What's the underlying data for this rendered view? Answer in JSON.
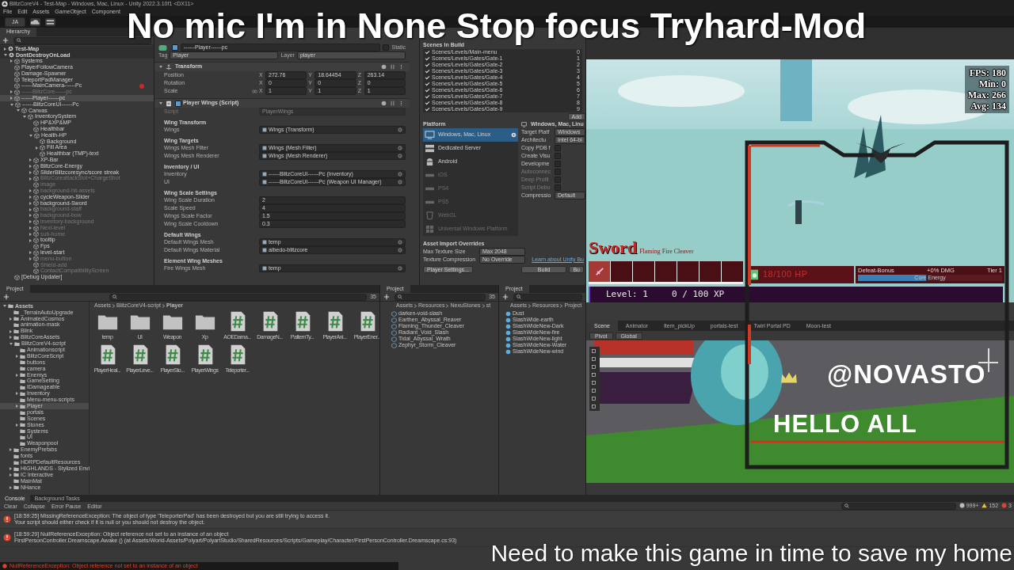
{
  "window": {
    "title": "BlitzCoreV4 - Test-Map - Windows, Mac, Linux - Unity 2022.3.10f1 <DX11>"
  },
  "menu": [
    "File",
    "Edit",
    "Assets",
    "GameObject",
    "Component"
  ],
  "toolbar": {
    "account": "JA"
  },
  "hierarchy": {
    "title": "Hierarchy",
    "items": [
      {
        "name": "Test-Map",
        "kind": "scene",
        "active": true,
        "selected": false,
        "expanded": false
      },
      {
        "name": "DontDestroyOnLoad",
        "kind": "scene",
        "active": true,
        "selected": false,
        "expanded": true,
        "children": [
          {
            "name": "Systems",
            "kind": "object",
            "active": true,
            "selected": false,
            "expanded": false
          },
          {
            "name": "PlayerFollowCamera",
            "kind": "object",
            "active": true,
            "selected": false
          },
          {
            "name": "Damage-Spawner",
            "kind": "object",
            "active": true,
            "selected": false
          },
          {
            "name": "TeleportPadManager",
            "kind": "object",
            "active": true,
            "selected": false
          },
          {
            "name": "------MainCamera------Pc",
            "kind": "object",
            "active": true,
            "selected": false,
            "marker": true
          },
          {
            "name": "------BlitzCore------pc",
            "kind": "object",
            "active": false,
            "selected": false,
            "expanded": false
          },
          {
            "name": "------Player------pc",
            "kind": "object",
            "active": true,
            "selected": true,
            "expanded": false
          },
          {
            "name": "------BlitzCoreUI------Pc",
            "kind": "object",
            "active": true,
            "selected": false,
            "expanded": true,
            "children": [
              {
                "name": "Canvas",
                "kind": "object",
                "active": true,
                "selected": false,
                "expanded": true,
                "children": [
                  {
                    "name": "InventorySystem",
                    "kind": "object",
                    "active": true,
                    "selected": false,
                    "expanded": true,
                    "children": [
                      {
                        "name": "HP&XP&MP",
                        "kind": "object",
                        "active": true,
                        "selected": false
                      },
                      {
                        "name": "Healthbar",
                        "kind": "object",
                        "active": true,
                        "selected": false
                      },
                      {
                        "name": "Health-HP",
                        "kind": "object",
                        "active": true,
                        "selected": false,
                        "expanded": true,
                        "children": [
                          {
                            "name": "Background",
                            "kind": "object",
                            "active": true,
                            "selected": false
                          },
                          {
                            "name": "Fill Area",
                            "kind": "object",
                            "active": true,
                            "selected": false,
                            "expanded": false
                          },
                          {
                            "name": "Healthbar (TMP)-text",
                            "kind": "object",
                            "active": true,
                            "selected": false
                          }
                        ]
                      },
                      {
                        "name": "XP-Bar",
                        "kind": "object",
                        "active": true,
                        "selected": false,
                        "expanded": false
                      },
                      {
                        "name": "BlitzCore-Energy",
                        "kind": "object",
                        "active": true,
                        "selected": false,
                        "expanded": false
                      },
                      {
                        "name": "SliderBlitzcoresync/score streak",
                        "kind": "object",
                        "active": true,
                        "selected": false,
                        "expanded": false
                      },
                      {
                        "name": "BlitzCoreattackSlot+ChargeShot",
                        "kind": "object",
                        "active": false,
                        "selected": false,
                        "expanded": false
                      },
                      {
                        "name": "image",
                        "kind": "object",
                        "active": false,
                        "selected": false
                      },
                      {
                        "name": "background-hit-assets",
                        "kind": "object",
                        "active": false,
                        "selected": false,
                        "expanded": false
                      },
                      {
                        "name": "cycleWeapon-Slider",
                        "kind": "object",
                        "active": true,
                        "selected": false,
                        "expanded": false
                      },
                      {
                        "name": "background-Sword",
                        "kind": "object",
                        "active": true,
                        "selected": false,
                        "expanded": false
                      },
                      {
                        "name": "background-staff",
                        "kind": "object",
                        "active": false,
                        "selected": false,
                        "expanded": false
                      },
                      {
                        "name": "background-bow",
                        "kind": "object",
                        "active": false,
                        "selected": false,
                        "expanded": false
                      },
                      {
                        "name": "inventory-background",
                        "kind": "object",
                        "active": false,
                        "selected": false,
                        "expanded": false
                      },
                      {
                        "name": "Next-level",
                        "kind": "object",
                        "active": false,
                        "selected": false,
                        "expanded": false
                      },
                      {
                        "name": "sub-home",
                        "kind": "object",
                        "active": false,
                        "selected": false,
                        "expanded": false
                      },
                      {
                        "name": "tooltip",
                        "kind": "object",
                        "active": true,
                        "selected": false,
                        "expanded": false
                      },
                      {
                        "name": "Fps",
                        "kind": "object",
                        "active": true,
                        "selected": false
                      },
                      {
                        "name": "level-start",
                        "kind": "object",
                        "active": true,
                        "selected": false,
                        "expanded": false
                      },
                      {
                        "name": "menu-button",
                        "kind": "object",
                        "active": false,
                        "selected": false,
                        "expanded": false
                      },
                      {
                        "name": "Shield-add",
                        "kind": "object",
                        "active": false,
                        "selected": false
                      },
                      {
                        "name": "ContactCompatibilityScreen",
                        "kind": "object",
                        "active": false,
                        "selected": false
                      }
                    ]
                  }
                ]
              }
            ]
          },
          {
            "name": "[Debug Updater]",
            "kind": "object",
            "active": true,
            "selected": false
          }
        ]
      }
    ]
  },
  "inspector": {
    "object_name": "------Player------pc",
    "active": true,
    "static_label": "Static",
    "static": false,
    "tag_label": "Tag",
    "tag": "Player",
    "layer_label": "Layer",
    "layer": "player",
    "transform": {
      "title": "Transform",
      "expanded": true,
      "rows": [
        {
          "label": "Position",
          "values": [
            {
              "axis": "X",
              "value": "272.76"
            },
            {
              "axis": "Y",
              "value": "18.64454"
            },
            {
              "axis": "Z",
              "value": "263.14"
            }
          ]
        },
        {
          "label": "Rotation",
          "values": [
            {
              "axis": "X",
              "value": "0"
            },
            {
              "axis": "Y",
              "value": "0"
            },
            {
              "axis": "Z",
              "value": "0"
            }
          ]
        },
        {
          "label": "Scale",
          "values": [
            {
              "axis": "X",
              "value": "1"
            },
            {
              "axis": "Y",
              "value": "1"
            },
            {
              "axis": "Z",
              "value": "1"
            }
          ]
        }
      ]
    },
    "component": {
      "title": "Player Wings (Script)",
      "expanded": true,
      "enabled": true,
      "script_label": "Script",
      "script": "PlayerWings",
      "sections": [
        {
          "heading": "Wing Transform",
          "fields": [
            {
              "label": "Wings",
              "kind": "object",
              "value": "Wings (Transform)"
            }
          ]
        },
        {
          "heading": "Wing Targets",
          "fields": [
            {
              "label": "Wings Mesh Filter",
              "kind": "object",
              "value": "Wings (Mesh Filter)"
            },
            {
              "label": "Wings Mesh Renderer",
              "kind": "object",
              "value": "Wings (Mesh Renderer)"
            }
          ]
        },
        {
          "heading": "Inventory / UI",
          "fields": [
            {
              "label": "Inventory",
              "kind": "object",
              "value": "------BlitzCoreUI------Pc (Inventory)"
            },
            {
              "label": "UI",
              "kind": "object",
              "value": "------BlitzCoreUI------Pc (Weapon UI Manager)"
            }
          ]
        },
        {
          "heading": "Wing Scale Settings",
          "fields": [
            {
              "label": "Wing Scale Duration",
              "kind": "number",
              "value": "2"
            },
            {
              "label": "Scale Speed",
              "kind": "number",
              "value": "4"
            },
            {
              "label": "Wings Scale Factor",
              "kind": "number",
              "value": "1.5"
            },
            {
              "label": "Wing Scale Cooldown",
              "kind": "number",
              "value": "0.3"
            }
          ]
        },
        {
          "heading": "Default Wings",
          "fields": [
            {
              "label": "Default Wings Mesh",
              "kind": "object",
              "value": "temp"
            },
            {
              "label": "Default Wings Material",
              "kind": "object",
              "value": "albedo-blitzcore"
            }
          ]
        },
        {
          "heading": "Element Wing Meshes",
          "fields": [
            {
              "label": "Fire Wings Mesh",
              "kind": "object",
              "value": "temp"
            }
          ]
        }
      ]
    }
  },
  "build_settings": {
    "scenes_title": "Scenes In Build",
    "scenes": [
      {
        "path": "Scenes/Levels/Main-menu",
        "index": "0",
        "checked": true
      },
      {
        "path": "Scenes/Levels/Gates/Gate-1",
        "index": "1",
        "checked": true
      },
      {
        "path": "Scenes/Levels/Gates/Gate-2",
        "index": "2",
        "checked": true
      },
      {
        "path": "Scenes/Levels/Gates/Gate-3",
        "index": "3",
        "checked": true
      },
      {
        "path": "Scenes/Levels/Gates/Gate-4",
        "index": "4",
        "checked": true
      },
      {
        "path": "Scenes/Levels/Gates/Gate-5",
        "index": "5",
        "checked": true
      },
      {
        "path": "Scenes/Levels/Gates/Gate-6",
        "index": "6",
        "checked": true
      },
      {
        "path": "Scenes/Levels/Gates/Gate-7",
        "index": "7",
        "checked": true
      },
      {
        "path": "Scenes/Levels/Gates/Gate-8",
        "index": "8",
        "checked": true
      },
      {
        "path": "Scenes/Levels/Gates/Gate-9",
        "index": "9",
        "checked": true
      }
    ],
    "add_button": "Add",
    "platform_title": "Platform",
    "platforms": [
      {
        "name": "Windows, Mac, Linux",
        "kind": "desktop",
        "selected": true,
        "disabled": false
      },
      {
        "name": "Dedicated Server",
        "kind": "server",
        "selected": false,
        "disabled": false
      },
      {
        "name": "Android",
        "kind": "android",
        "selected": false,
        "disabled": false
      },
      {
        "name": "iOS",
        "kind": "console",
        "selected": false,
        "disabled": true
      },
      {
        "name": "PS4",
        "kind": "console",
        "selected": false,
        "disabled": true
      },
      {
        "name": "PS5",
        "kind": "console",
        "selected": false,
        "disabled": true
      },
      {
        "name": "WebGL",
        "kind": "web",
        "selected": false,
        "disabled": true
      },
      {
        "name": "Universal Windows Platform",
        "kind": "windows",
        "selected": false,
        "disabled": true
      }
    ],
    "target_title": "Windows, Mac, Linu",
    "options": [
      {
        "label": "Target Platf",
        "kind": "dropdown",
        "value": "Windows",
        "disabled": false
      },
      {
        "label": "Architectu",
        "kind": "dropdown",
        "value": "Intel 64-bi",
        "disabled": false
      },
      {
        "label": "Copy PDB f",
        "kind": "checkbox",
        "checked": false,
        "disabled": false
      },
      {
        "label": "Create Visu",
        "kind": "checkbox",
        "checked": false,
        "disabled": false
      },
      {
        "label": "Developme",
        "kind": "checkbox",
        "checked": false,
        "disabled": false
      },
      {
        "label": "Autoconnec",
        "kind": "checkbox",
        "checked": false,
        "disabled": true
      },
      {
        "label": "Deep Profil",
        "kind": "checkbox",
        "checked": false,
        "disabled": true
      },
      {
        "label": "Script Debu",
        "kind": "checkbox",
        "checked": false,
        "disabled": true
      },
      {
        "label": "Compressio",
        "kind": "dropdown",
        "value": "Default",
        "disabled": false
      }
    ],
    "overrides_title": "Asset Import Overrides",
    "overrides": [
      {
        "label": "Max Texture Size",
        "value": "Max 2048"
      },
      {
        "label": "Texture Compression",
        "value": "No Override"
      }
    ],
    "learn_link": "Learn about Unity Bu",
    "player_settings": "Player Settings...",
    "build_button": "Build",
    "build_run_button": "Bu"
  },
  "game_view": {
    "stats": [
      "FPS: 180",
      "Min: 0",
      "Max: 266",
      "Avg: 134"
    ],
    "weapon_type": "Sword",
    "weapon_name": "Flaming Fire Cleaver",
    "slots": [
      {
        "filled": true
      },
      {
        "filled": false
      },
      {
        "filled": false
      },
      {
        "filled": false
      },
      {
        "filled": false
      },
      {
        "filled": false
      },
      {
        "filled": false
      }
    ],
    "hp_text": "18/100 HP",
    "bonus_label": "Defeat-Bonus",
    "bonus_damage": "+0% DMG",
    "tier": "Tier 1",
    "energy": {
      "label": "Core Energy",
      "level": 0.47
    },
    "level_text": "Level: 1",
    "xp": {
      "text": "0 / 100 XP",
      "level": 0
    }
  },
  "scene_view": {
    "tabs": [
      {
        "label": "Scene",
        "selected": true
      },
      {
        "label": "Animator",
        "selected": false
      },
      {
        "label": "Item_pickUp",
        "selected": false
      },
      {
        "label": "portals-test",
        "selected": false
      },
      {
        "label": "Twirl Portal PD",
        "selected": false
      },
      {
        "label": "Moon-test",
        "selected": false
      }
    ],
    "pivot": "Pivot",
    "space": "Global"
  },
  "projects": [
    {
      "title": "Project",
      "count": "35",
      "breadcrumb": [
        "Assets",
        "BlitzCoreV4-script",
        "Player"
      ],
      "tree": [
        {
          "name": "Assets",
          "selected": false,
          "expanded": true,
          "children": [
            {
              "name": "_TerrainAutoUpgrade",
              "selected": false
            },
            {
              "name": "AnimatedCosmos",
              "selected": false,
              "expanded": false
            },
            {
              "name": "animation-mask",
              "selected": false
            },
            {
              "name": "Blink",
              "selected": false,
              "expanded": false
            },
            {
              "name": "BlitzCoreAssets",
              "selected": false,
              "expanded": false
            },
            {
              "name": "BlitzCoreV4-script",
              "selected": false,
              "expanded": true,
              "children": [
                {
                  "name": "Animationscript",
                  "selected": false
                },
                {
                  "name": "BlitzCoreScript",
                  "selected": false,
                  "expanded": false
                },
                {
                  "name": "buttons",
                  "selected": false
                },
                {
                  "name": "camera",
                  "selected": false
                },
                {
                  "name": "Enemys",
                  "selected": false,
                  "expanded": false
                },
                {
                  "name": "GameSetting",
                  "selected": false
                },
                {
                  "name": "IDamageable",
                  "selected": false
                },
                {
                  "name": "Inventory",
                  "selected": false,
                  "expanded": false
                },
                {
                  "name": "Menu-menu-scripts",
                  "selected": false
                },
                {
                  "name": "Player",
                  "selected": true,
                  "expanded": false
                },
                {
                  "name": "portals",
                  "selected": false
                },
                {
                  "name": "Scenes",
                  "selected": false
                },
                {
                  "name": "Stones",
                  "selected": false,
                  "expanded": false
                },
                {
                  "name": "Systems",
                  "selected": false
                },
                {
                  "name": "UI",
                  "selected": false
                },
                {
                  "name": "Weaponpool",
                  "selected": false
                }
              ]
            },
            {
              "name": "EnemyPrefabs",
              "selected": false,
              "expanded": false
            },
            {
              "name": "fonts",
              "selected": false
            },
            {
              "name": "HDRPDefaultResources",
              "selected": false
            },
            {
              "name": "HIGHLANDS - Stylized Envi",
              "selected": false,
              "expanded": false
            },
            {
              "name": "IC Interactive",
              "selected": false,
              "expanded": false
            },
            {
              "name": "MainMat",
              "selected": false
            },
            {
              "name": "NHance",
              "selected": false,
              "expanded": false
            }
          ]
        }
      ],
      "assets": [
        {
          "name": "temp",
          "kind": "folder"
        },
        {
          "name": "UI",
          "kind": "folder"
        },
        {
          "name": "Weapon",
          "kind": "folder"
        },
        {
          "name": "Xp",
          "kind": "folder"
        },
        {
          "name": "AOEDama...",
          "kind": "script"
        },
        {
          "name": "DamageN...",
          "kind": "script"
        },
        {
          "name": "PatternTy...",
          "kind": "script"
        },
        {
          "name": "PlayerAni...",
          "kind": "script"
        },
        {
          "name": "PlayerEner...",
          "kind": "script"
        },
        {
          "name": "PlayerHeal...",
          "kind": "script"
        },
        {
          "name": "PlayerLeve...",
          "kind": "script"
        },
        {
          "name": "PlayerSto...",
          "kind": "script"
        },
        {
          "name": "PlayerWings",
          "kind": "script"
        },
        {
          "name": "Teleporter...",
          "kind": "script"
        }
      ]
    },
    {
      "title": "Project",
      "count": "35",
      "breadcrumb": [
        "Assets",
        "Resources",
        "NexuStones",
        "st"
      ],
      "assets": [
        {
          "name": "darken-void-slash",
          "kind": "prefab"
        },
        {
          "name": "Earthen_Abyssal_Reaver",
          "kind": "prefab"
        },
        {
          "name": "Flaming_Thunder_Cleaver",
          "kind": "prefab"
        },
        {
          "name": "Radiant_Void_Slash",
          "kind": "prefab"
        },
        {
          "name": "Tidal_Abyssal_Wrath",
          "kind": "prefab"
        },
        {
          "name": "Zephyr_Storm_Cleaver",
          "kind": "prefab"
        }
      ]
    },
    {
      "title": "Project",
      "breadcrumb": [
        "Assets",
        "Resources",
        "Project"
      ],
      "assets": [
        {
          "name": "Dust",
          "kind": "particle"
        },
        {
          "name": "SlashWide-earth",
          "kind": "particle"
        },
        {
          "name": "SlashWideNew-Dark",
          "kind": "particle"
        },
        {
          "name": "SlashWideNew-fire",
          "kind": "particle"
        },
        {
          "name": "SlashWideNew-light",
          "kind": "particle"
        },
        {
          "name": "SlashWideNew-Water",
          "kind": "particle"
        },
        {
          "name": "SlashWideNew-wind",
          "kind": "particle"
        }
      ]
    }
  ],
  "console": {
    "tabs": [
      {
        "label": "Console",
        "selected": true
      },
      {
        "label": "Background Tasks",
        "selected": false
      }
    ],
    "buttons": [
      "Clear",
      "Collapse",
      "Error Pause",
      "Editor"
    ],
    "counts": [
      {
        "kind": "info",
        "text": "999+"
      },
      {
        "kind": "warning",
        "text": "152"
      },
      {
        "kind": "error",
        "text": "3"
      }
    ],
    "messages": [
      {
        "kind": "error",
        "lines": [
          "[18:59:25] MissingReferenceException: The object of type 'TeleporterPad' has been destroyed but you are still trying to access it.",
          "Your script should either check if it is null or you should not destroy the object."
        ]
      },
      {
        "kind": "error",
        "lines": [
          "[18:59:29] NullReferenceException: Object reference not set to an instance of an object",
          "FirstPersonController.Dreamscape.Awake () (at Assets/World-Assets/Polyart/PolyartStudio/SharedResources/Scripts/Gameplay/Character/FirstPersonController.Dreamscape.cs:93)"
        ]
      }
    ],
    "status": "NullReferenceException: Object reference not set to an instance of an object"
  },
  "overlay": {
    "top_text": "No mic I'm in None Stop focus Tryhard-Mod",
    "handle": "@NOVASTO",
    "greeting": "HELLO ALL",
    "bottom_text": "Need to make this game in time to save my home"
  }
}
